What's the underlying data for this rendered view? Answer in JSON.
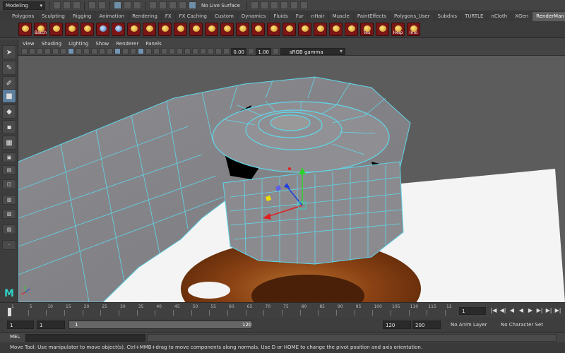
{
  "status_line": {
    "menu_set": "Modeling",
    "live_surface": "No Live Surface"
  },
  "shelf_tabs": [
    "Polygons",
    "Sculpting",
    "Rigging",
    "Animation",
    "Rendering",
    "FX",
    "FX Caching",
    "Custom",
    "Dynamics",
    "Fluids",
    "Fur",
    "nHair",
    "Muscle",
    "PaintEffects",
    "Polygons_User",
    "Subdivs",
    "TURTLE",
    "nCloth",
    "XGen",
    "RenderMan"
  ],
  "active_shelf_tab": "RenderMan",
  "shelf_icon_labels": {
    "batch": "Batch",
    "tex": "Tex",
    "help": "Help",
    "info": "Info"
  },
  "panel_menu": [
    "View",
    "Shading",
    "Lighting",
    "Show",
    "Renderer",
    "Panels"
  ],
  "panel_toolbar": {
    "exposure": "0.00",
    "gamma_value": "1.00",
    "color_space": "sRGB gamma"
  },
  "time_slider": {
    "ticks": [
      "1",
      "5",
      "10",
      "15",
      "20",
      "25",
      "30",
      "35",
      "40",
      "45",
      "50",
      "55",
      "60",
      "65",
      "70",
      "75",
      "80",
      "85",
      "90",
      "95",
      "100",
      "105",
      "110",
      "115",
      "12"
    ],
    "current_frame": "1"
  },
  "range_slider": {
    "start": "1",
    "playback_start": "1",
    "range_bar_start": "1",
    "range_bar_end": "120",
    "playback_end": "120",
    "end": "200",
    "anim_layer": "No Anim Layer",
    "character_set": "No Character Set"
  },
  "command_line": {
    "label": "MEL"
  },
  "help_line": "Move Tool: Use manipulator to move object(s). Ctrl+MMB+drag to move components along normals. Use D or HOME to change the pivot position and axis orientation.",
  "colors": {
    "viewport_bg": "#5c5c5c",
    "wireframe": "#5fd6ea",
    "mesh_face": "#8a8a8e",
    "active_tab": "#5e5e5e",
    "shelf_red": "#7a1616"
  }
}
